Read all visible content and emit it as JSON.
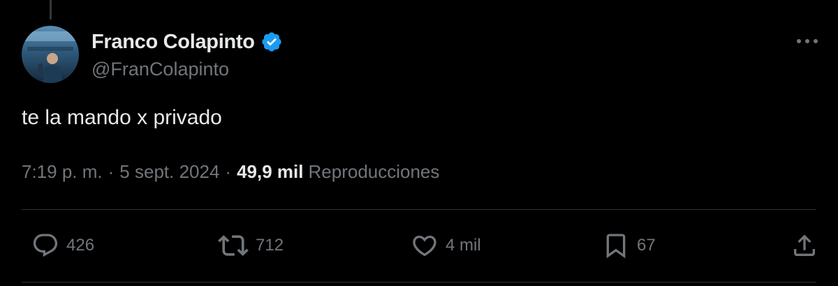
{
  "author": {
    "display_name": "Franco Colapinto",
    "handle": "@FranColapinto",
    "verified": true,
    "verified_color": "#1d9bf0"
  },
  "tweet": {
    "text": "te la mando x privado",
    "time": "7:19 p. m.",
    "separator": "·",
    "date": "5 sept. 2024",
    "views_count": "49,9 mil",
    "views_label": "Reproducciones"
  },
  "actions": {
    "replies": "426",
    "reposts": "712",
    "likes": "4 mil",
    "bookmarks": "67"
  },
  "icons": {
    "more": "more-horizontal-icon",
    "reply": "reply-icon",
    "repost": "repost-icon",
    "like": "heart-icon",
    "bookmark": "bookmark-icon",
    "share": "share-icon"
  },
  "colors": {
    "background": "#000000",
    "text_primary": "#e7e9ea",
    "text_secondary": "#71767b",
    "divider": "#2f3336"
  }
}
